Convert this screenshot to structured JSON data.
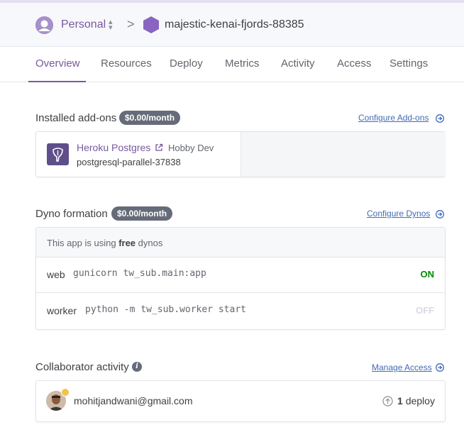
{
  "header": {
    "account_name": "Personal",
    "account_switch_icon": "chevron-up-down-icon",
    "breadcrumb_separator": ">",
    "app_name": "majestic-kenai-fjords-88385",
    "accent_color": "#79589f"
  },
  "tabs": [
    {
      "label": "Overview",
      "active": true
    },
    {
      "label": "Resources",
      "active": false
    },
    {
      "label": "Deploy",
      "active": false
    },
    {
      "label": "Metrics",
      "active": false
    },
    {
      "label": "Activity",
      "active": false
    },
    {
      "label": "Access",
      "active": false
    },
    {
      "label": "Settings",
      "active": false
    }
  ],
  "addons": {
    "title": "Installed add-ons",
    "price_badge": "$0.00/month",
    "configure_link": "Configure Add-ons",
    "items": [
      {
        "name": "Heroku Postgres",
        "plan": "Hobby Dev",
        "resource": "postgresql-parallel-37838",
        "icon": "heroku-postgres-icon"
      }
    ]
  },
  "dynos": {
    "title": "Dyno formation",
    "price_badge": "$0.00/month",
    "configure_link": "Configure Dynos",
    "note_prefix": "This app is using",
    "note_tier": "free",
    "note_suffix": "dynos",
    "rows": [
      {
        "type": "web",
        "command": "gunicorn tw_sub.main:app",
        "status": "ON",
        "status_color": "#008a00"
      },
      {
        "type": "worker",
        "command": "python -m tw_sub.worker start",
        "status": "OFF",
        "status_color": "#d7dae0"
      }
    ]
  },
  "collaborators": {
    "title": "Collaborator activity",
    "manage_link": "Manage Access",
    "items": [
      {
        "email": "mohitjandwani@gmail.com",
        "deploy_count": "1",
        "deploy_label": "deploy"
      }
    ]
  }
}
